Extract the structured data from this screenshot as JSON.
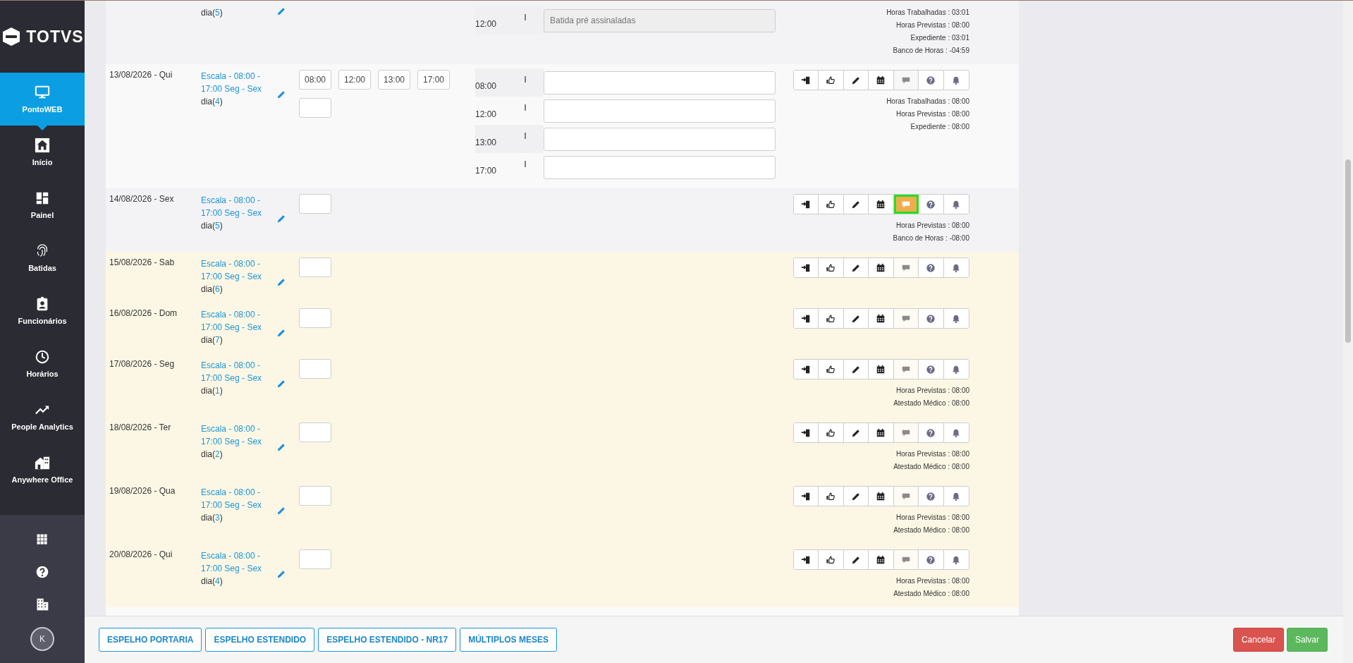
{
  "sidebar": {
    "logo": "TOTVS",
    "items": [
      {
        "kind": "monitor",
        "label": "PontoWEB",
        "selected": true
      },
      {
        "kind": "home",
        "label": "Início",
        "selected": false
      },
      {
        "kind": "panel",
        "label": "Painel",
        "selected": false
      },
      {
        "kind": "fingerprint",
        "label": "Batidas",
        "selected": false
      },
      {
        "kind": "badge",
        "label": "Funcionários",
        "selected": false
      },
      {
        "kind": "clock",
        "label": "Horários",
        "selected": false
      },
      {
        "kind": "trend",
        "label": "People Analytics",
        "selected": false
      },
      {
        "kind": "office",
        "label": "Anywhere Office",
        "selected": false
      }
    ],
    "tools": [
      {
        "kind": "apps"
      },
      {
        "kind": "help"
      },
      {
        "kind": "company"
      }
    ],
    "avatar": "K"
  },
  "days": [
    {
      "day": {
        "prefix": "dia(",
        "number": "5",
        "suffix": ")"
      },
      "entry_field": false,
      "marked": false,
      "marks": [
        {
          "time": "12:00",
          "placeholder": "Batida pré assinaladas",
          "disabled": true
        }
      ],
      "summaries": [
        "Horas Trabalhadas : 03:01",
        "Horas Previstas : 08:00",
        "Expediente : 03:01",
        "Banco de Horas : -04:59"
      ]
    },
    {
      "date": "13/08/2026 - Qui",
      "schedule": "Escala - 08:00 - 17:00 Seg - Sex",
      "day": {
        "prefix": "dia(",
        "number": "4",
        "suffix": ")"
      },
      "planned": [
        "08:00",
        "12:00",
        "13:00",
        "17:00"
      ],
      "entry_field": true,
      "marked": false,
      "marks": [
        {
          "time": "08:00",
          "disabled": false
        },
        {
          "time": "12:00",
          "disabled": false
        },
        {
          "time": "13:00",
          "disabled": false
        },
        {
          "time": "17:00",
          "disabled": false
        }
      ],
      "comment_selected": false,
      "summaries": [
        "Horas Trabalhadas : 08:00",
        "Horas Previstas : 08:00",
        "Expediente : 08:00"
      ]
    },
    {
      "date": "14/08/2026 - Sex",
      "schedule": "Escala - 08:00 - 17:00 Seg - Sex",
      "day": {
        "prefix": "dia(",
        "number": "5",
        "suffix": ")"
      },
      "entry_field": true,
      "marked": false,
      "comment_selected": true,
      "summaries": [
        "Horas Previstas : 08:00",
        "Banco de Horas : -08:00"
      ]
    },
    {
      "date": "15/08/2026 - Sab",
      "schedule": "Escala - 08:00 - 17:00 Seg - Sex",
      "day": {
        "prefix": "dia(",
        "number": "6",
        "suffix": ")"
      },
      "entry_field": true,
      "marked": true,
      "comment_selected": false
    },
    {
      "date": "16/08/2026 - Dom",
      "schedule": "Escala - 08:00 - 17:00 Seg - Sex",
      "day": {
        "prefix": "dia(",
        "number": "7",
        "suffix": ")"
      },
      "entry_field": true,
      "marked": true,
      "comment_selected": false
    },
    {
      "date": "17/08/2026 - Seg",
      "schedule": "Escala - 08:00 - 17:00 Seg - Sex",
      "day": {
        "prefix": "dia(",
        "number": "1",
        "suffix": ")"
      },
      "entry_field": true,
      "marked": true,
      "comment_selected": false,
      "summaries": [
        "Horas Previstas : 08:00",
        "Atestado Médico : 08:00"
      ]
    },
    {
      "date": "18/08/2026 - Ter",
      "schedule": "Escala - 08:00 - 17:00 Seg - Sex",
      "day": {
        "prefix": "dia(",
        "number": "2",
        "suffix": ")"
      },
      "entry_field": true,
      "marked": true,
      "comment_selected": false,
      "summaries": [
        "Horas Previstas : 08:00",
        "Atestado Médico : 08:00"
      ]
    },
    {
      "date": "19/08/2026 - Qua",
      "schedule": "Escala - 08:00 - 17:00 Seg - Sex",
      "day": {
        "prefix": "dia(",
        "number": "3",
        "suffix": ")"
      },
      "entry_field": true,
      "marked": true,
      "comment_selected": false,
      "summaries": [
        "Horas Previstas : 08:00",
        "Atestado Médico : 08:00"
      ]
    },
    {
      "date": "20/08/2026 - Qui",
      "schedule": "Escala - 08:00 - 17:00 Seg - Sex",
      "day": {
        "prefix": "dia(",
        "number": "4",
        "suffix": ")"
      },
      "entry_field": true,
      "marked": true,
      "comment_selected": false,
      "summaries": [
        "Horas Previstas : 08:00",
        "Atestado Médico : 08:00"
      ]
    }
  ],
  "footer": {
    "reports": [
      "ESPELHO PORTARIA",
      "ESPELHO ESTENDIDO",
      "ESPELHO ESTENDIDO - NR17",
      "MÚLTIPLOS MESES"
    ],
    "actions": [
      {
        "kind": "cancel",
        "label": "Cancelar"
      },
      {
        "kind": "save",
        "label": "Salvar"
      }
    ]
  }
}
